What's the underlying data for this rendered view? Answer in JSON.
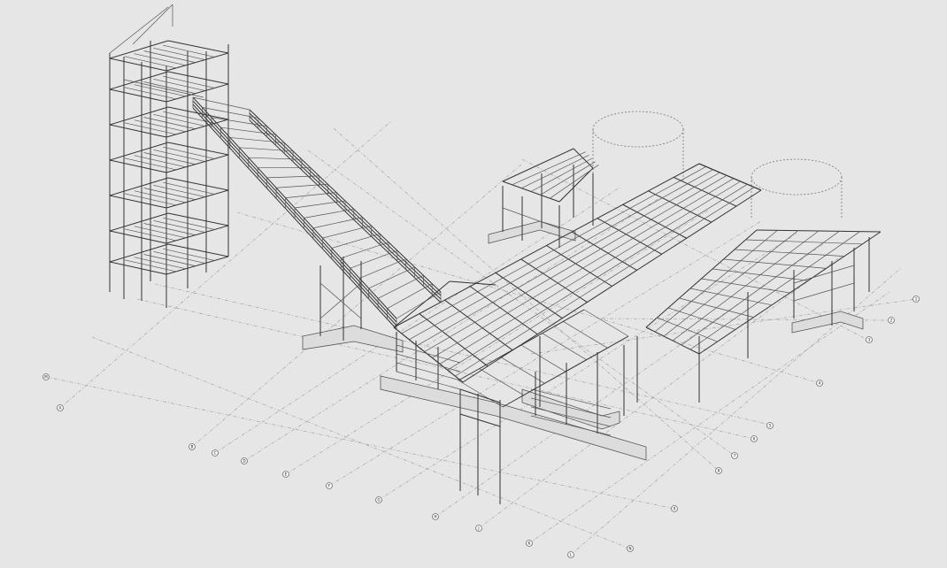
{
  "drawing": {
    "background": "#e6e6e6",
    "line_color": "#333333",
    "grid_color": "#9a9a9a"
  },
  "grid_bubbles": [
    {
      "id": "bubble-1",
      "label": "1"
    },
    {
      "id": "bubble-2",
      "label": "2"
    },
    {
      "id": "bubble-3",
      "label": "3"
    },
    {
      "id": "bubble-4",
      "label": "4"
    },
    {
      "id": "bubble-5",
      "label": "5"
    },
    {
      "id": "bubble-6",
      "label": "6"
    },
    {
      "id": "bubble-7",
      "label": "7"
    },
    {
      "id": "bubble-8",
      "label": "8"
    },
    {
      "id": "bubble-9",
      "label": "9"
    },
    {
      "id": "bubble-A",
      "label": "A"
    },
    {
      "id": "bubble-B",
      "label": "B"
    },
    {
      "id": "bubble-C",
      "label": "C"
    },
    {
      "id": "bubble-D",
      "label": "D"
    },
    {
      "id": "bubble-E",
      "label": "E"
    },
    {
      "id": "bubble-F",
      "label": "F"
    },
    {
      "id": "bubble-G",
      "label": "G"
    },
    {
      "id": "bubble-H",
      "label": "H"
    },
    {
      "id": "bubble-J",
      "label": "J"
    },
    {
      "id": "bubble-K",
      "label": "K"
    },
    {
      "id": "bubble-L",
      "label": "L"
    },
    {
      "id": "bubble-M",
      "label": "M"
    },
    {
      "id": "bubble-N",
      "label": "N"
    }
  ]
}
